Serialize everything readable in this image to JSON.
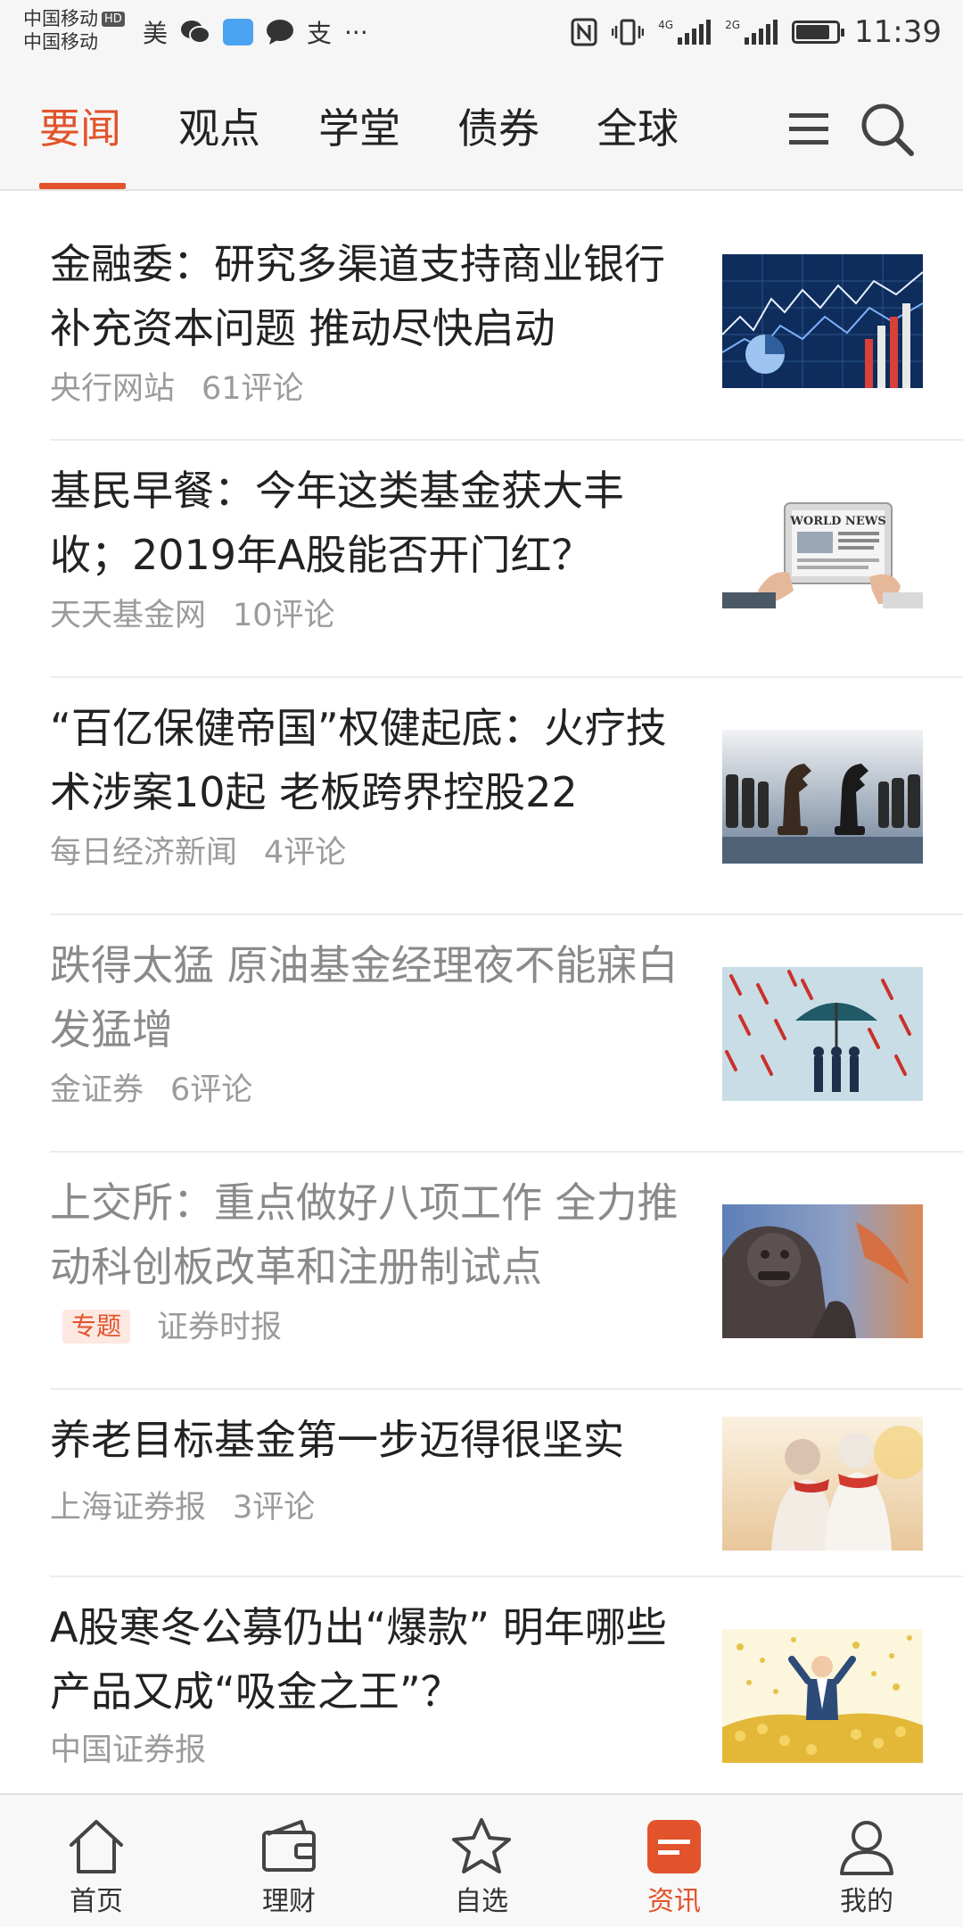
{
  "status_bar": {
    "carrier_1": "中国移动",
    "hd_badge": "HD",
    "carrier_2": "中国移动",
    "app_1": "美",
    "app_alipay": "支",
    "more": "···",
    "signal_1_tag": "4G",
    "signal_2_tag": "2G",
    "battery_level": 0.85,
    "time": "11:39"
  },
  "tabs": [
    {
      "label": "要闻",
      "active": true
    },
    {
      "label": "观点",
      "active": false
    },
    {
      "label": "学堂",
      "active": false
    },
    {
      "label": "债券",
      "active": false
    },
    {
      "label": "全球",
      "active": false
    }
  ],
  "news": [
    {
      "headline": "金融委：研究多渠道支持商业银行补充资本问题 推动尽快启动",
      "source": "央行网站",
      "comments": "61评论",
      "read": false,
      "thumb": "financial-chart-image"
    },
    {
      "headline": "基民早餐：今年这类基金获大丰收；2019年A股能否开门红？",
      "source": "天天基金网",
      "comments": "10评论",
      "read": false,
      "thumb": "world-news-tablet-image",
      "thumb_text": "WORLD NEWS"
    },
    {
      "headline": "“百亿保健帝国”权健起底：火疗技术涉案10起 老板跨界控股22",
      "source": "每日经济新闻",
      "comments": "4评论",
      "read": false,
      "thumb": "chess-knights-image"
    },
    {
      "headline": "跌得太猛 原油基金经理夜不能寐白发猛增",
      "source": "金证券",
      "comments": "6评论",
      "read": true,
      "thumb": "umbrella-arrows-image"
    },
    {
      "headline": "上交所：重点做好八项工作 全力推动科创板改革和注册制试点",
      "tag": "专题",
      "source": "证券时报",
      "comments": "",
      "read": true,
      "thumb": "stone-lion-image"
    },
    {
      "headline": "养老目标基金第一步迈得很坚实",
      "source": "上海证券报",
      "comments": "3评论",
      "read": false,
      "thumb": "elderly-couple-image"
    },
    {
      "headline": "A股寒冬公募仍出“爆款” 明年哪些产品又成“吸金之王”？",
      "source": "中国证券报",
      "comments": "",
      "read": false,
      "thumb": "gold-coins-man-image"
    }
  ],
  "bottom_nav": [
    {
      "label": "首页",
      "icon": "home-icon",
      "active": false
    },
    {
      "label": "理财",
      "icon": "wallet-icon",
      "active": false
    },
    {
      "label": "自选",
      "icon": "star-icon",
      "active": false
    },
    {
      "label": "资讯",
      "icon": "news-icon",
      "active": true
    },
    {
      "label": "我的",
      "icon": "profile-icon",
      "active": false
    }
  ],
  "colors": {
    "accent": "#e2532c",
    "text": "#222222",
    "muted": "#9b9b9b",
    "read": "#8a8a8a"
  }
}
